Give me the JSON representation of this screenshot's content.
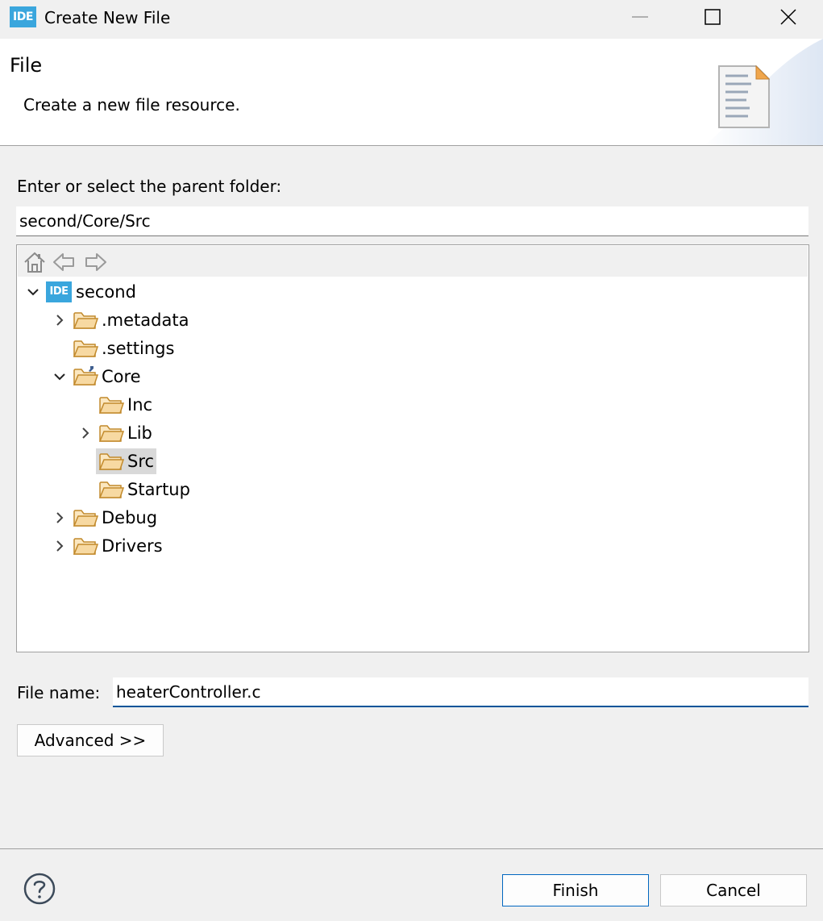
{
  "window": {
    "app_icon_text": "IDE",
    "title": "Create New File",
    "controls": [
      "minimize-icon",
      "maximize-icon",
      "close-icon"
    ]
  },
  "banner": {
    "title": "File",
    "description": "Create a new file resource.",
    "icon": "document-icon"
  },
  "parent_folder": {
    "label": "Enter or select the parent folder:",
    "value": "second/Core/Src"
  },
  "tree_toolbar": {
    "icons": [
      "home-icon",
      "back-arrow-icon",
      "forward-arrow-icon"
    ]
  },
  "tree": [
    {
      "label": "second",
      "expanded": true,
      "type": "project",
      "icon_text": "IDE"
    },
    {
      "label": ".metadata",
      "expanded": false,
      "has_children": true,
      "type": "folder"
    },
    {
      "label": ".settings",
      "has_children": false,
      "type": "folder"
    },
    {
      "label": "Core",
      "expanded": true,
      "type": "source-folder"
    },
    {
      "label": "Inc",
      "has_children": false,
      "type": "folder"
    },
    {
      "label": "Lib",
      "expanded": false,
      "has_children": true,
      "type": "folder"
    },
    {
      "label": "Src",
      "has_children": false,
      "type": "folder",
      "selected": true
    },
    {
      "label": "Startup",
      "has_children": false,
      "type": "folder"
    },
    {
      "label": "Debug",
      "expanded": false,
      "has_children": true,
      "type": "folder"
    },
    {
      "label": "Drivers",
      "expanded": false,
      "has_children": true,
      "type": "folder"
    }
  ],
  "file_name": {
    "label": "File name:",
    "value": "heaterController.c"
  },
  "buttons": {
    "advanced": "Advanced >>",
    "finish": "Finish",
    "cancel": "Cancel"
  },
  "colors": {
    "accent": "#0067c0",
    "ide_blue": "#3aa6dd",
    "folder_fill": "#f7d9a2",
    "folder_stroke": "#c28a2c",
    "selection": "#d9d9d9"
  }
}
